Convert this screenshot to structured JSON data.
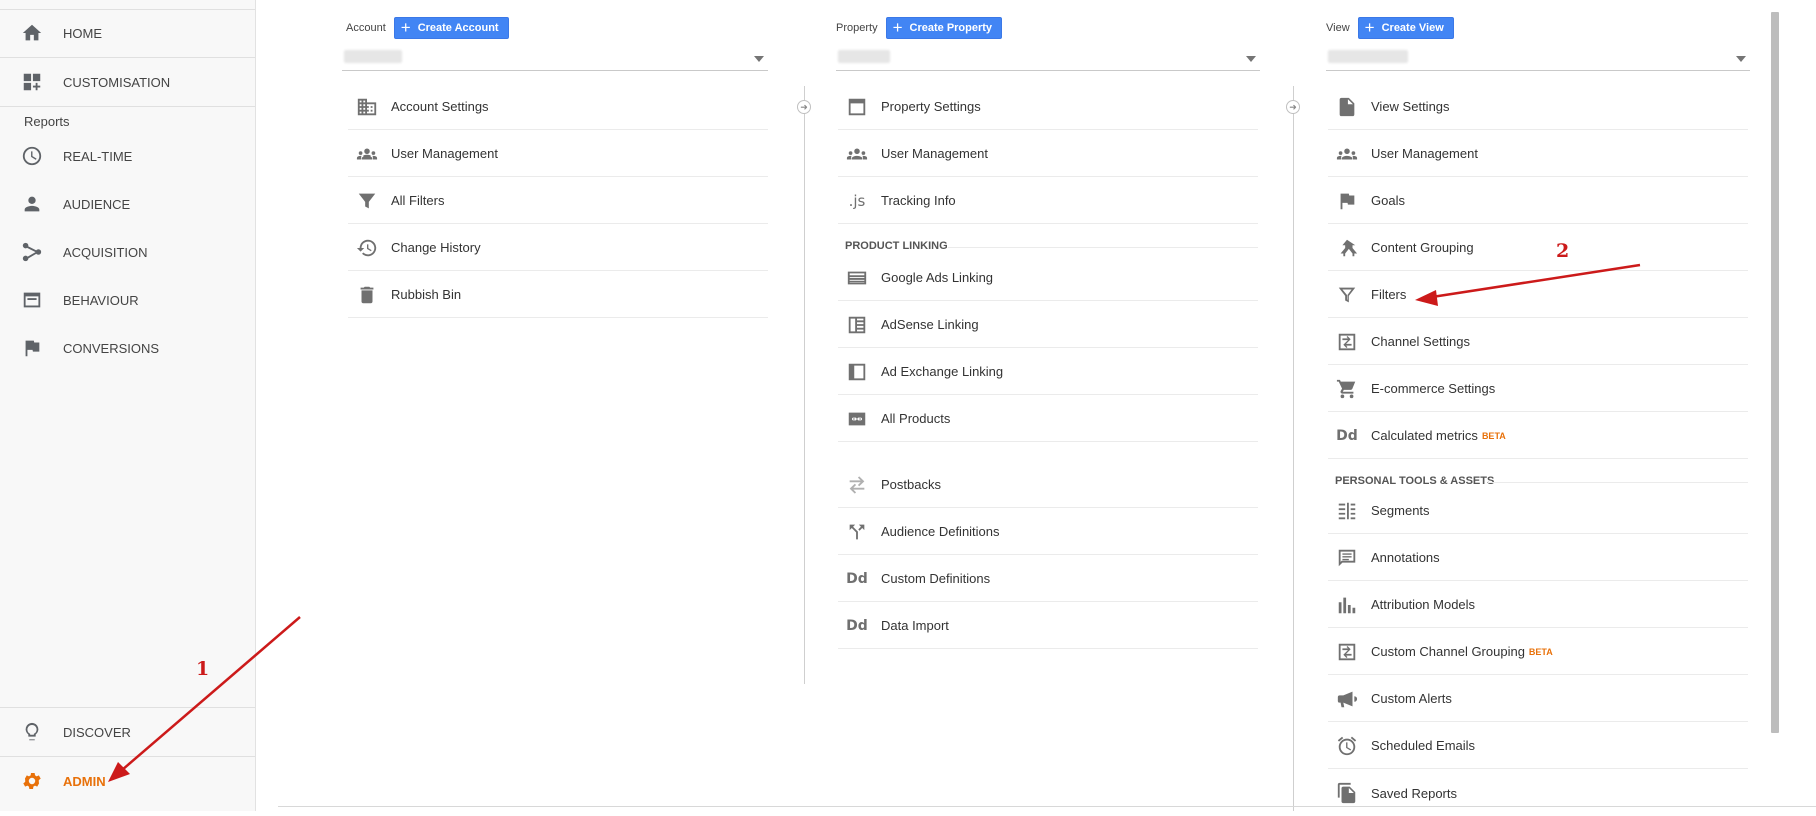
{
  "sidebar": {
    "top_items": [
      {
        "label": "HOME",
        "icon": "home-icon"
      },
      {
        "label": "CUSTOMISATION",
        "icon": "dashboard-plus-icon"
      }
    ],
    "reports_label": "Reports",
    "report_items": [
      {
        "label": "REAL-TIME",
        "icon": "clock-icon"
      },
      {
        "label": "AUDIENCE",
        "icon": "person-icon"
      },
      {
        "label": "ACQUISITION",
        "icon": "acquisition-icon"
      },
      {
        "label": "BEHAVIOUR",
        "icon": "behaviour-icon"
      },
      {
        "label": "CONVERSIONS",
        "icon": "flag-icon"
      }
    ],
    "discover_label": "DISCOVER",
    "admin_label": "ADMIN",
    "admin_color": "#e8710a"
  },
  "account": {
    "label": "Account",
    "create_label": "Create Account",
    "items": [
      "Account Settings",
      "User Management",
      "All Filters",
      "Change History",
      "Rubbish Bin"
    ]
  },
  "property": {
    "label": "Property",
    "create_label": "Create Property",
    "items": [
      "Property Settings",
      "User Management",
      "Tracking Info"
    ],
    "section_label": "PRODUCT LINKING",
    "linking_items": [
      "Google Ads Linking",
      "AdSense Linking",
      "Ad Exchange Linking",
      "All Products"
    ],
    "more_items": [
      "Postbacks",
      "Audience Definitions",
      "Custom Definitions",
      "Data Import"
    ],
    "icon_text_js": ".js",
    "icon_text_dd": "Dd"
  },
  "view": {
    "label": "View",
    "create_label": "Create View",
    "items": [
      "View Settings",
      "User Management",
      "Goals",
      "Content Grouping",
      "Filters",
      "Channel Settings",
      "E-commerce Settings",
      "Calculated metrics"
    ],
    "beta_label": "BETA",
    "section_label": "PERSONAL TOOLS & ASSETS",
    "tools_items": [
      "Segments",
      "Annotations",
      "Attribution Models",
      "Custom Channel Grouping",
      "Custom Alerts",
      "Scheduled Emails",
      "Saved Reports"
    ],
    "icon_text_dd": "Dd"
  },
  "annotations": {
    "step1": "1",
    "step2": "2",
    "arrow_color": "#cc1a1a"
  },
  "colors": {
    "button": "#4285f4",
    "accent": "#e8710a"
  }
}
